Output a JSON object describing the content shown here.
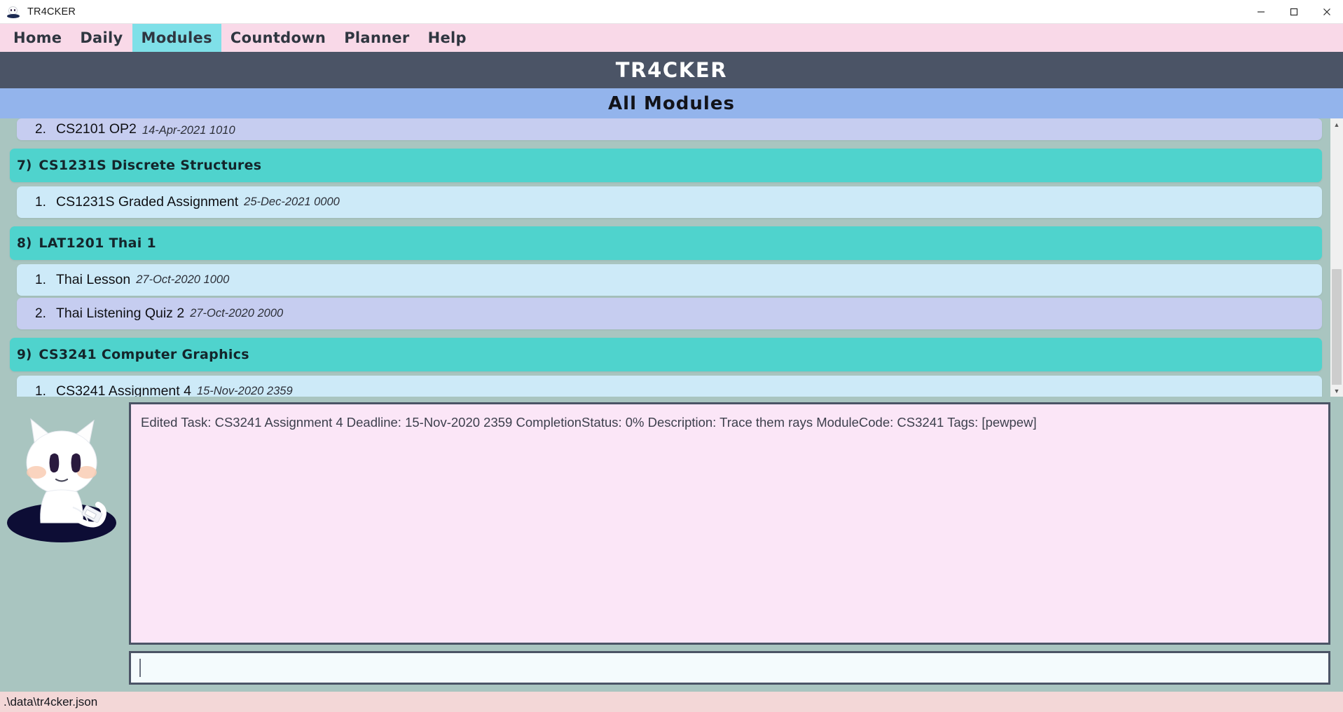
{
  "window": {
    "title": "TR4CKER",
    "icon": "cat-icon",
    "controls": {
      "minimize": "─",
      "maximize": "☐",
      "close": "✕"
    }
  },
  "menubar": {
    "items": [
      {
        "label": "Home",
        "active": false
      },
      {
        "label": "Daily",
        "active": false
      },
      {
        "label": "Modules",
        "active": true
      },
      {
        "label": "Countdown",
        "active": false
      },
      {
        "label": "Planner",
        "active": false
      },
      {
        "label": "Help",
        "active": false
      }
    ]
  },
  "header": {
    "app_title": "TR4CKER",
    "section_title": "All Modules"
  },
  "list": {
    "partial_top_task": {
      "index": "2.",
      "name": "CS2101 OP2",
      "due": "14-Apr-2021 1010"
    },
    "modules": [
      {
        "index": "7)",
        "name": "CS1231S Discrete Structures",
        "tasks": [
          {
            "index": "1.",
            "name": "CS1231S Graded Assignment",
            "due": "25-Dec-2021 0000"
          }
        ]
      },
      {
        "index": "8)",
        "name": "LAT1201 Thai 1",
        "tasks": [
          {
            "index": "1.",
            "name": "Thai Lesson",
            "due": "27-Oct-2020 1000"
          },
          {
            "index": "2.",
            "name": "Thai Listening Quiz 2",
            "due": "27-Oct-2020 2000"
          }
        ]
      },
      {
        "index": "9)",
        "name": "CS3241 Computer Graphics",
        "tasks": [
          {
            "index": "1.",
            "name": "CS3241 Assignment 4",
            "due": "15-Nov-2020 2359"
          }
        ]
      }
    ]
  },
  "scrollbar": {
    "up_arrow": "▲",
    "down_arrow": "▼"
  },
  "response": {
    "text": "Edited Task: CS3241 Assignment 4 Deadline: 15-Nov-2020 2359 CompletionStatus: 0% Description: Trace them rays ModuleCode: CS3241 Tags: [pewpew]"
  },
  "command_input": {
    "value": "",
    "placeholder": ""
  },
  "statusbar": {
    "path": ".\\data\\tr4cker.json"
  },
  "colors": {
    "menubar_bg": "#f9d9e8",
    "menu_active": "#7fe0e8",
    "app_title_bg": "#4b5466",
    "section_title_bg": "#93b4ec",
    "panel_bg": "#a9c5c0",
    "module_row": "#4fd3cd",
    "task_row_odd": "#cdeaf8",
    "task_row_even": "#c6cdf0",
    "response_bg": "#fbe6f7",
    "input_bg": "#f4fbfd",
    "statusbar_bg": "#f3d7d7"
  }
}
